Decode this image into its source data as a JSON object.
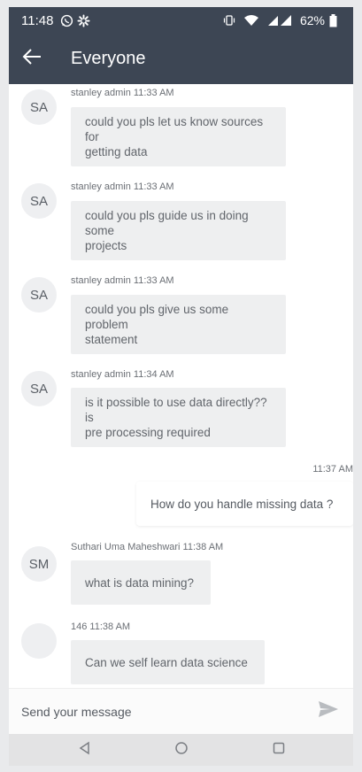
{
  "status_bar": {
    "time": "11:48",
    "battery": "62%",
    "icons": [
      "whatsapp-icon",
      "settings-icon",
      "vibrate-icon",
      "wifi-icon",
      "signal-icon",
      "battery-icon"
    ]
  },
  "header": {
    "title": "Everyone",
    "back_icon": "arrow-left-icon"
  },
  "messages": [
    {
      "initials": "SA",
      "meta": "stanley admin 11:33 AM",
      "lines": [
        "could you pls let us know sources for",
        "getting data"
      ]
    },
    {
      "initials": "SA",
      "meta": "stanley admin 11:33 AM",
      "lines": [
        "could you pls guide us in doing some",
        "projects"
      ]
    },
    {
      "initials": "SA",
      "meta": "stanley admin 11:33 AM",
      "lines": [
        "could you pls give us some problem",
        "statement"
      ]
    },
    {
      "initials": "SA",
      "meta": "stanley admin 11:34 AM",
      "lines": [
        "is it possible to use data directly?? is",
        "pre processing required"
      ]
    },
    {
      "outgoing": true,
      "time": "11:37 AM",
      "text": "How do you handle missing data ?"
    },
    {
      "initials": "SM",
      "meta": "Suthari Uma Maheshwari 11:38 AM",
      "lines": [
        "what is data mining?"
      ]
    },
    {
      "initials": "",
      "meta": "146 11:38 AM",
      "lines": [
        "Can we self learn data science"
      ]
    }
  ],
  "composer": {
    "placeholder": "Send your message",
    "send_icon": "send-icon"
  },
  "nav": {
    "icons": [
      "back-triangle-icon",
      "home-circle-icon",
      "recents-square-icon"
    ]
  },
  "colors": {
    "header_bg": "#3d4654",
    "bubble_bg": "#eeeff0",
    "avatar_bg": "#eeeff1",
    "page_bg": "#ffffff"
  }
}
